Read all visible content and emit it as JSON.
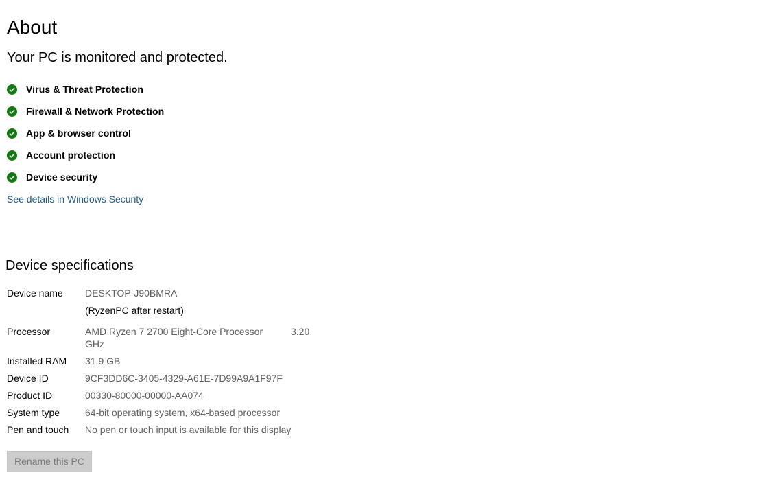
{
  "page": {
    "title": "About",
    "subtitle": "Your PC is monitored and protected."
  },
  "protection": {
    "items": [
      {
        "label": "Virus & Threat Protection",
        "icon": "check-circle-icon"
      },
      {
        "label": "Firewall & Network Protection",
        "icon": "check-circle-icon"
      },
      {
        "label": "App & browser control",
        "icon": "check-circle-icon"
      },
      {
        "label": "Account protection",
        "icon": "check-circle-icon"
      },
      {
        "label": "Device security",
        "icon": "check-circle-icon"
      }
    ],
    "details_link": "See details in Windows Security",
    "status_color": "#107c10"
  },
  "specs": {
    "title": "Device specifications",
    "device_name_label": "Device name",
    "device_name_value": "DESKTOP-J90BMRA",
    "device_name_note": "(RyzenPC after restart)",
    "processor_label": "Processor",
    "processor_value": "AMD Ryzen 7 2700 Eight-Core Processor",
    "processor_freq": "3.20",
    "processor_unit": "GHz",
    "ram_label": "Installed RAM",
    "ram_value": "31.9 GB",
    "device_id_label": "Device ID",
    "device_id_value": "9CF3DD6C-3405-4329-A61E-7D99A9A1F97F",
    "product_id_label": "Product ID",
    "product_id_value": "00330-80000-00000-AA074",
    "system_type_label": "System type",
    "system_type_value": "64-bit operating system, x64-based processor",
    "pen_touch_label": "Pen and touch",
    "pen_touch_value": "No pen or touch input is available for this display"
  },
  "actions": {
    "rename_label": "Rename this PC"
  },
  "colors": {
    "link": "#1e5b84",
    "secondary_text": "#5f5f5f",
    "button_bg": "#cccccc"
  }
}
